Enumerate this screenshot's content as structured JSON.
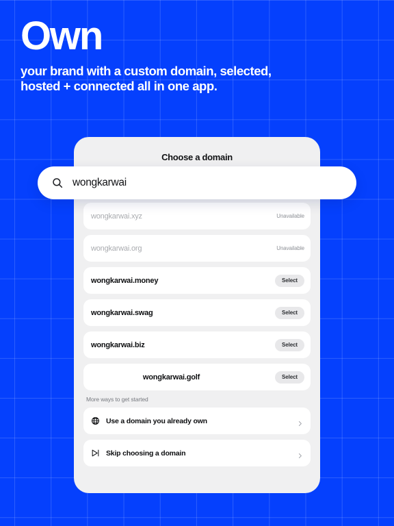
{
  "theme": {
    "brand_blue": "#0540fd",
    "card_bg": "#f0f0f1",
    "row_bg": "#ffffff",
    "muted_text": "#a9abaf",
    "select_pill_bg": "#e8e8ea"
  },
  "hero": {
    "title": "Own",
    "subtitle": "your brand with a custom domain, selected,\nhosted + connected all in one app."
  },
  "card": {
    "title": "Choose a domain",
    "more_ways_label": "More ways to get started"
  },
  "search": {
    "icon": "search-icon",
    "value": "wongkarwai",
    "placeholder": "Search for a domain"
  },
  "domains": [
    {
      "name": "wongkarwai.xyz",
      "status": "Unavailable",
      "available": false,
      "action": null,
      "centered": false
    },
    {
      "name": "wongkarwai.org",
      "status": "Unavailable",
      "available": false,
      "action": null,
      "centered": false
    },
    {
      "name": "wongkarwai.money",
      "status": null,
      "available": true,
      "action": "Select",
      "centered": false
    },
    {
      "name": "wongkarwai.swag",
      "status": null,
      "available": true,
      "action": "Select",
      "centered": false
    },
    {
      "name": "wongkarwai.biz",
      "status": null,
      "available": true,
      "action": "Select",
      "centered": false
    },
    {
      "name": "wongkarwai.golf",
      "status": null,
      "available": true,
      "action": "Select",
      "centered": true
    }
  ],
  "more_ways": [
    {
      "icon": "globe-icon",
      "label": "Use a domain you already own"
    },
    {
      "icon": "skip-forward-icon",
      "label": "Skip choosing a domain"
    }
  ]
}
